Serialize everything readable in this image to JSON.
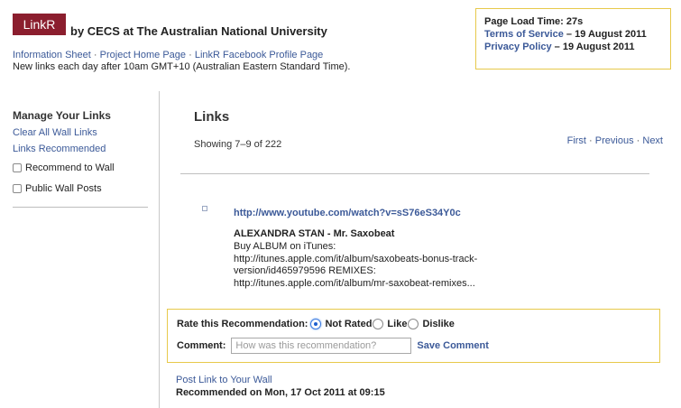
{
  "header": {
    "logo": "LinkR",
    "byline": "by CECS at The Australian National University",
    "links": [
      "Information Sheet",
      "Project Home Page",
      "LinkR Facebook Profile Page"
    ],
    "separator": "·",
    "note": "New links each day after 10am GMT+10 (Australian Eastern Standard Time)."
  },
  "info": {
    "load_time": "Page Load Time: 27s",
    "terms_label": "Terms of Service",
    "terms_date": "– 19 August 2011",
    "privacy_label": "Privacy Policy",
    "privacy_date": "– 19 August 2011"
  },
  "sidebar": {
    "title": "Manage Your Links",
    "links": [
      "Clear All Wall Links",
      "Links Recommended"
    ],
    "checkboxes": [
      {
        "label": "Recommend to Wall",
        "checked": false
      },
      {
        "label": "Public Wall Posts",
        "checked": false
      }
    ]
  },
  "main": {
    "title": "Links",
    "showing": "Showing 7–9 of 222",
    "pager": {
      "first": "First",
      "previous": "Previous",
      "next": "Next",
      "separator": "·"
    },
    "post": {
      "url": "http://www.youtube.com/watch?v=sS76eS34Y0c",
      "title": "ALEXANDRA STAN - Mr. Saxobeat",
      "description": "Buy ALBUM on iTunes:\nhttp://itunes.apple.com/it/album/saxobeats-bonus-track-\nversion/id465979596 REMIXES:\nhttp://itunes.apple.com/it/album/mr-saxobeat-remixes..."
    },
    "rating": {
      "label": "Rate this Recommendation:",
      "options": [
        "Not Rated",
        "Like",
        "Dislike"
      ],
      "selected": "Not Rated",
      "comment_label": "Comment:",
      "comment_placeholder": "How was this recommendation?",
      "comment_value": "",
      "save_label": "Save Comment"
    },
    "post_link_label": "Post Link to Your Wall",
    "recommended_on": "Recommended on Mon, 17 Oct 2011 at 09:15"
  },
  "colors": {
    "brand": "#8b1e2e",
    "link": "#3b5998",
    "box_border": "#e7c94b"
  }
}
